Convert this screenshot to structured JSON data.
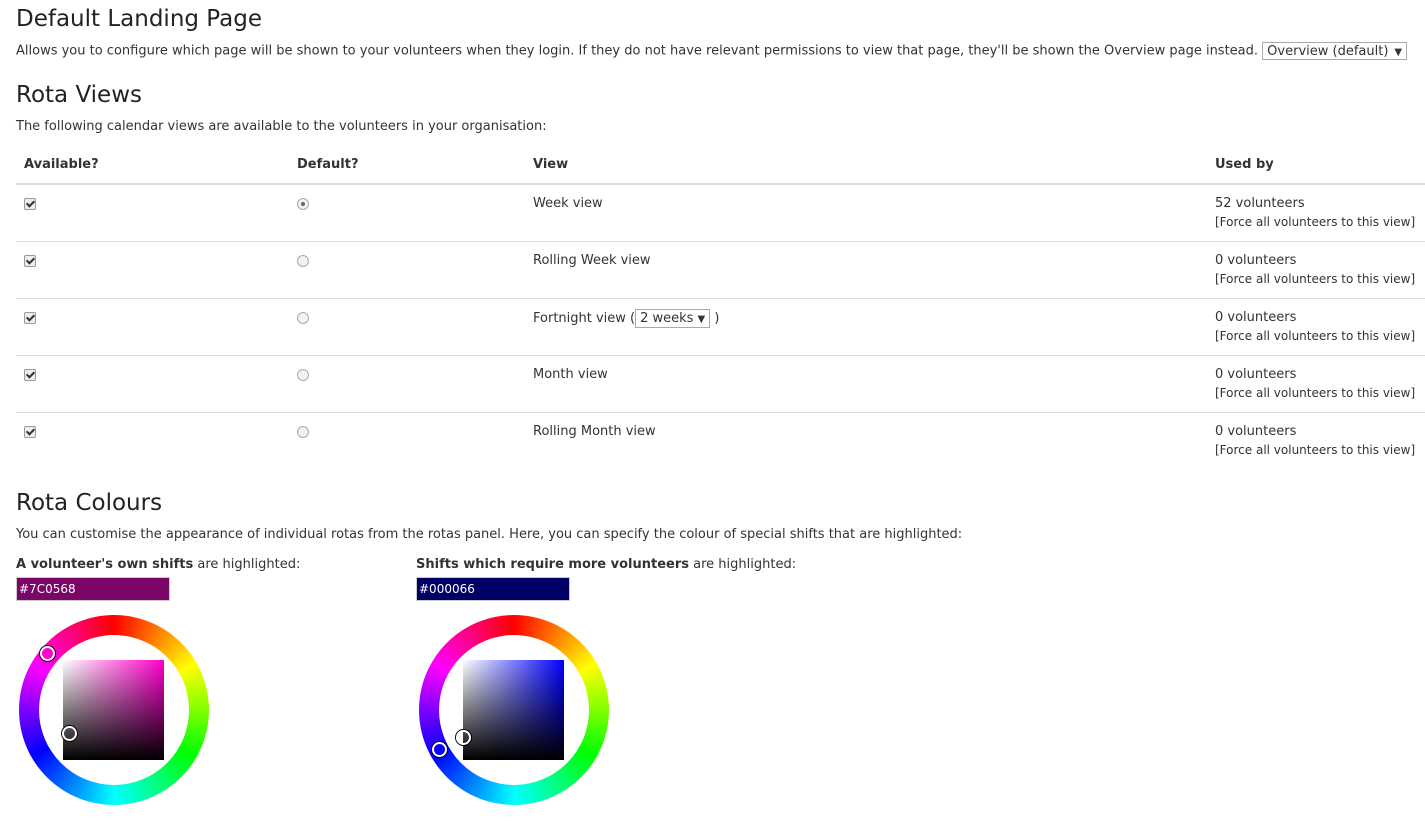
{
  "landing": {
    "title": "Default Landing Page",
    "description": "Allows you to configure which page will be shown to your volunteers when they login. If they do not have relevant permissions to view that page, they'll be shown the Overview page instead.",
    "select_value": "Overview (default)"
  },
  "views": {
    "title": "Rota Views",
    "description": "The following calendar views are available to the volunteers in your organisation:",
    "columns": {
      "available": "Available?",
      "default": "Default?",
      "view": "View",
      "used_by": "Used by"
    },
    "force_label": "[Force all volunteers to this view]",
    "rows": [
      {
        "view": "Week view",
        "used_by": "52 volunteers",
        "available": true,
        "default": true
      },
      {
        "view": "Rolling Week view",
        "used_by": "0 volunteers",
        "available": true,
        "default": false
      },
      {
        "view": "Fortnight view (",
        "view_suffix": ")",
        "select_value": "2 weeks",
        "used_by": "0 volunteers",
        "available": true,
        "default": false
      },
      {
        "view": "Month view",
        "used_by": "0 volunteers",
        "available": true,
        "default": false
      },
      {
        "view": "Rolling Month view",
        "used_by": "0 volunteers",
        "available": true,
        "default": false
      }
    ]
  },
  "colours": {
    "title": "Rota Colours",
    "description": "You can customise the appearance of individual rotas from the rotas panel. Here, you can specify the colour of special shifts that are highlighted:",
    "own": {
      "label_bold": "A volunteer's own shifts",
      "label_rest": " are highlighted:",
      "value": "#7C0568",
      "hue_color": "#ff00cc"
    },
    "more": {
      "label_bold": "Shifts which require more volunteers",
      "label_rest": " are highlighted:",
      "value": "#000066",
      "hue_color": "#0000ff"
    }
  }
}
